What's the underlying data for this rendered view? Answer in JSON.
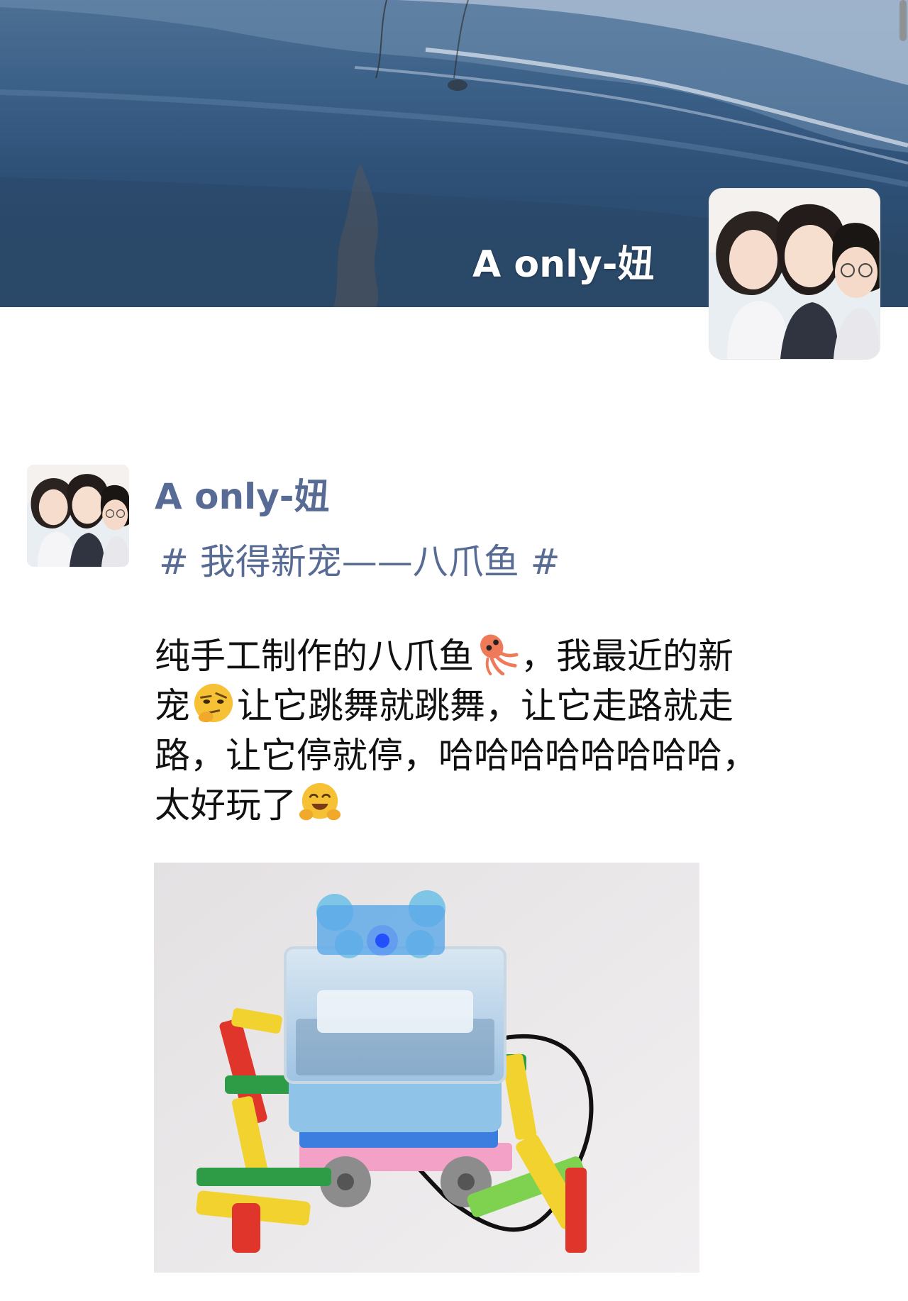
{
  "profile": {
    "cover_name": "A only-妞",
    "cover_photo_icon": "beach-shoreline-photo",
    "avatar_icon": "anime-friends-avatar"
  },
  "post": {
    "author": "A only-妞",
    "topic": "# 我得新宠——八爪鱼 #",
    "text_lines": [
      {
        "before": "纯手工制作的八爪鱼",
        "emoji": "squid-emoji",
        "after": "，我最近的新"
      },
      {
        "before": "宠",
        "emoji": "thinking-face-emoji",
        "after": "让它跳舞就跳舞，让它走路就走"
      },
      {
        "before": "路，让它停就停，哈哈哈哈哈哈哈哈，",
        "emoji": "",
        "after": ""
      },
      {
        "before": "太好玩了",
        "emoji": "hugging-face-emoji",
        "after": ""
      }
    ],
    "photo_icon": "lego-robot-octopus-photo"
  },
  "colors": {
    "link_blue": "#576b95",
    "body_text": "#111111",
    "background": "#ffffff"
  }
}
